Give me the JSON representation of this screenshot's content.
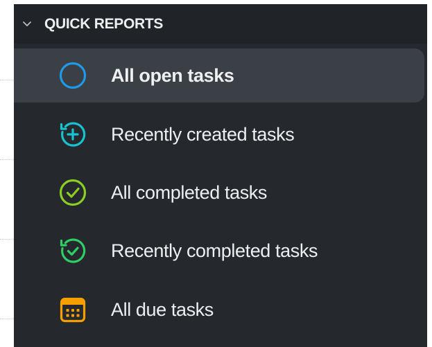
{
  "quick_reports": {
    "title": "QUICK REPORTS",
    "items": [
      {
        "label": "All open tasks",
        "icon": "circle-icon",
        "color": "#1e9ae6",
        "selected": true
      },
      {
        "label": "Recently created tasks",
        "icon": "refresh-plus-icon",
        "color": "#17c3d1",
        "selected": false
      },
      {
        "label": "All completed tasks",
        "icon": "check-circle-icon",
        "color": "#8bcf23",
        "selected": false
      },
      {
        "label": "Recently completed tasks",
        "icon": "refresh-check-icon",
        "color": "#2fcf65",
        "selected": false
      },
      {
        "label": "All due tasks",
        "icon": "calendar-icon",
        "color": "#f5a000",
        "selected": false
      }
    ]
  },
  "colors": {
    "panel_background": "#25292e",
    "header_background": "#202428",
    "selected_background": "#3b4046",
    "text": "#edeff1"
  }
}
